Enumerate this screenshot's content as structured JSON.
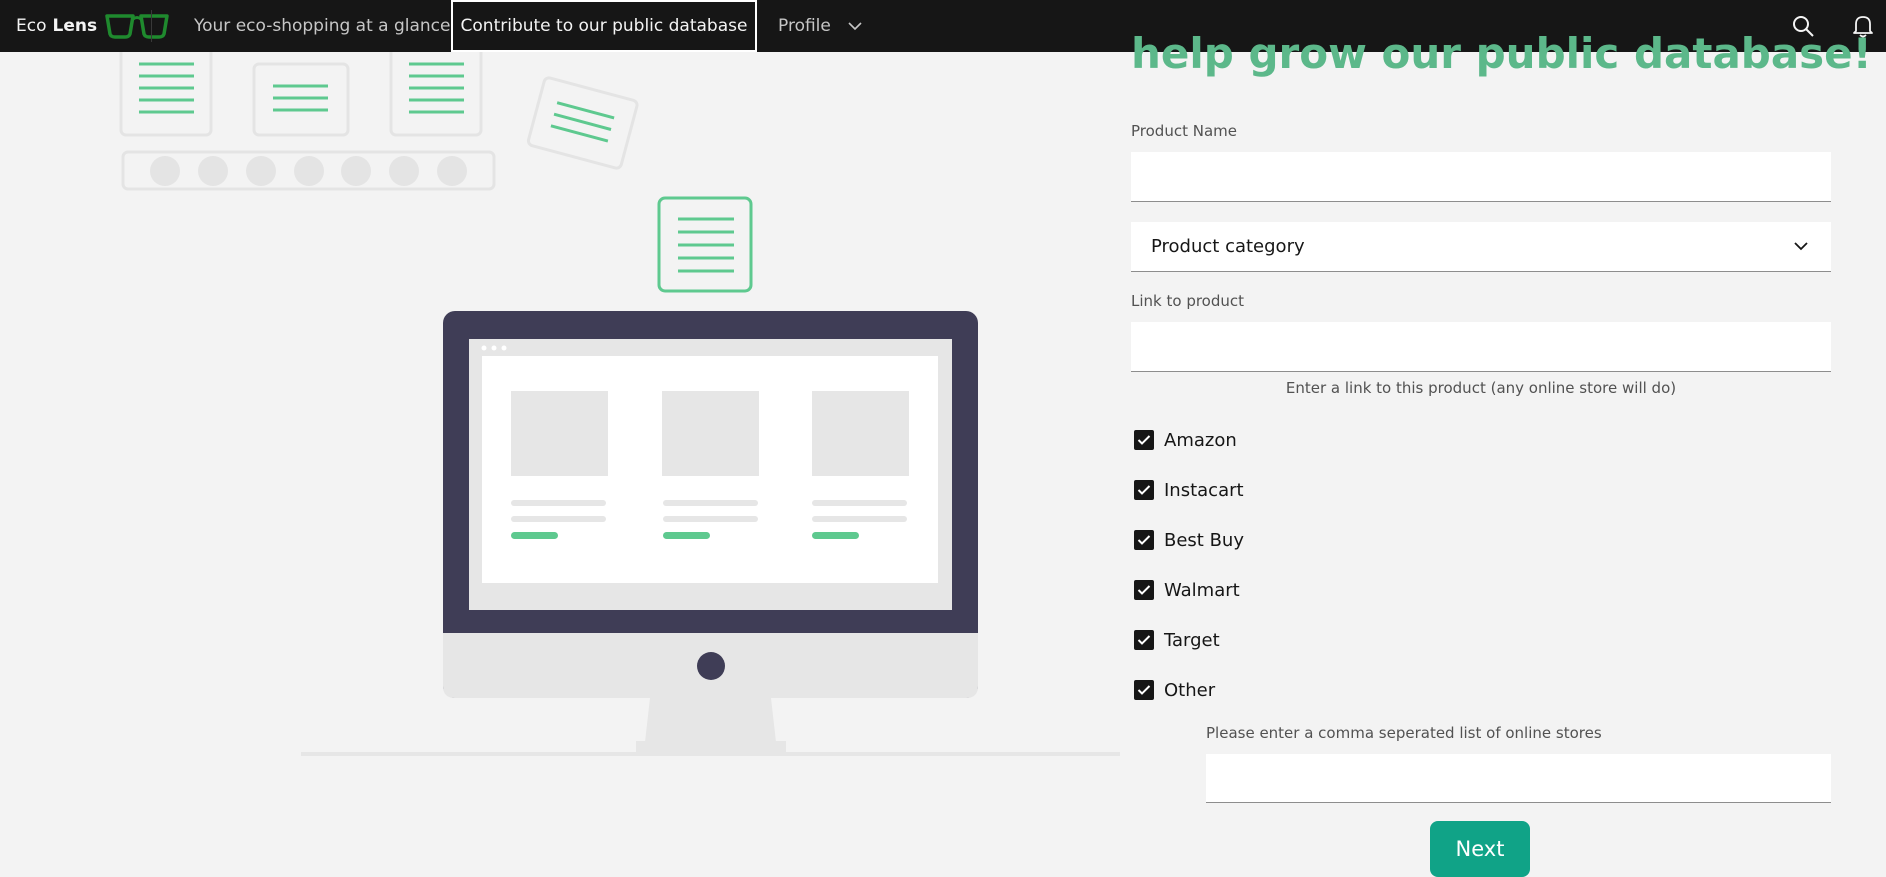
{
  "header": {
    "brand_prefix": "Eco",
    "brand_bold": "Lens",
    "nav": [
      {
        "label": "Your eco-shopping at a glance"
      },
      {
        "label": "Contribute to our public database"
      },
      {
        "label": "Profile"
      }
    ],
    "icons": [
      "search-icon",
      "notification-icon"
    ]
  },
  "form": {
    "headline": "help grow our public database!",
    "product_name_label": "Product Name",
    "product_name_value": "",
    "category_value": "Product category",
    "link_label": "Link to product",
    "link_value": "",
    "link_helper": "Enter a link to this product (any online store will do)",
    "stores": [
      {
        "label": "Amazon",
        "checked": true
      },
      {
        "label": "Instacart",
        "checked": true
      },
      {
        "label": "Best Buy",
        "checked": true
      },
      {
        "label": "Walmart",
        "checked": true
      },
      {
        "label": "Target",
        "checked": true
      },
      {
        "label": "Other",
        "checked": true
      }
    ],
    "other_label": "Please enter a comma seperated list of online stores",
    "other_value": "",
    "next_label": "Next"
  },
  "colors": {
    "accent_green": "#5cb88a",
    "button_teal": "#10a387",
    "header_bg": "#161616",
    "monitor_dark": "#3f3d56"
  }
}
